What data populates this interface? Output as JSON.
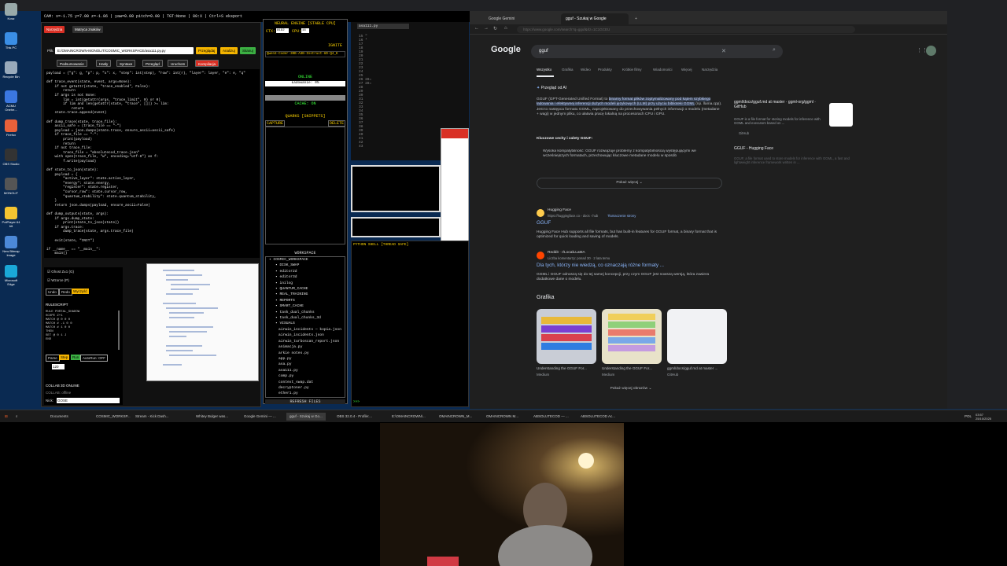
{
  "desktop_icons": [
    {
      "label": "Kosz",
      "color": "#9aa"
    },
    {
      "label": "This PC",
      "color": "#3a8ee6"
    },
    {
      "label": "Recycle Bin",
      "color": "#9ab"
    },
    {
      "label": "ACMU Onehe...",
      "color": "#3b77e0"
    },
    {
      "label": "Firefox",
      "color": "#e8603a"
    },
    {
      "label": "OBS Studio",
      "color": "#333"
    },
    {
      "label": "MONOLIT",
      "color": "#555"
    },
    {
      "label": "PotPlayer 64 bit",
      "color": "#f4c531"
    },
    {
      "label": "New Bitmap Image",
      "color": "#4c89d8"
    },
    {
      "label": "Microsoft Edge",
      "color": "#1aa8d8"
    }
  ],
  "left_app": {
    "status": "CAM: x=-1.75 y=7.00 z=-1.86 | yaw=0.00 pitch=0.00 | TGT:None | 80:X | Ctrl+S eksport",
    "tab_active": "Narzędzia",
    "tab_inactive": "Matryca znaków",
    "file_label": "Plik:",
    "file_path": "E:/OMAINCROWN-MONOLIT/COSMIC_WORKSPACE/asa111.py.py",
    "btn_load": "Przeglądaj",
    "btn_analyze": "Analizuj",
    "btn_scan": "Skanuj",
    "actions": [
      "Podsumowanie",
      "Hasły",
      "Syntaxe",
      "Przegląd",
      "Uruchom",
      "Kompilacja"
    ],
    "code": "payload = {\"g\": g, \"p\": p, \"x\": x, \"step\": int(step), \"row\": int(r), \"layer\": layer, \"e\": e, \"q\"\n\ndef trace_event(state, event, args=None):\n    if not getattr(state, \"trace_enabled\", False):\n        return\n    if args is not None:\n        lim = int(getattr(args, \"trace_limit\", 0) or 0)\n        if lim and len(getattr(state, \"trace\", [])) >= lim:\n            return\n    state.trace.append(event)\n\ndef dump_trace(state, trace_file):\n    ascii_safe = (trace_file == \"-\")\n    payload = json.dumps(state.trace, ensure_ascii=ascii_safe)\n    if trace_file == \"-\":\n        print(payload)\n        return\n    if not trace_file:\n        trace_file = \"absolutecod_trace.json\"\n    with open(trace_file, \"w\", encoding=\"utf-8\") as f:\n        f.write(payload)\n\ndef state_to_json(state):\n    payload = {\n        \"active_layer\": state.active_layer,\n        \"energy\": state.energy,\n        \"register\": state.register,\n        \"cursor_row\": state.cursor_row,\n        \"quantum_stability\": state.quantum_stability,\n    }\n    return json.dumps(payload, ensure_ascii=False)\n\ndef dump_outputs(state, args):\n    if args.dump_state:\n        print(state_to_json(state))\n    if args.trace:\n        dump_trace(state, args.trace_file)\n\n    exit(state, \"INIT\")\n\nif __name__ == \"__main__\":\n    main()",
    "ghost_label": "Ghost Z±1 (G)",
    "pattern_label": "Wzorce (P)",
    "undo": "Undo",
    "redo": "Redo",
    "clear": "Wyczyść",
    "rulescript_title": "RULESCRIPT",
    "rulescript": "RULE PORTAL_SHADOW\nSCOPE Z+1\nMATCH @ 0 0 0\nMATCH # -1 0 0\nMATCH # 1 0 0\nTHEN\nSET @ 0 1 J\nEND",
    "parse": "Parse",
    "step": "Step",
    "run": "Run",
    "autorun": "AutoRun: OFF",
    "ms_value": "120",
    "collab_title": "COLLAB 3D ONLINE",
    "collab_line": "COLLAB: offline",
    "nick_label": "Nick:",
    "nick_value": "GOSE"
  },
  "neural": {
    "title": "NEURAL ENGINE [STABLE CPU]",
    "ctx_label": "CTX:",
    "ctx_value": "8192",
    "cpu_label": "CPU:",
    "cpu_value": "16",
    "ignite": "IGNITE",
    "model": "Qwen3-Coder-30B-A3B-Instruct-UD-Q4_K",
    "online": "ONLINE",
    "loading": "Ładowanie: 0%",
    "cache": "CACHE: ON",
    "quarks": "QUARKS [SNIPPETS]",
    "capture": "CAPTURE",
    "delete": "DELETE",
    "workspace_title": "WORKSPACE",
    "tree": [
      "COSMIC_WORKSPACE",
      "DISK_SWAP",
      "editor2d",
      "editor3d",
      "inilog",
      "QUANTUM_CACHE",
      "REAL_TRAINING",
      "REPORTS",
      "SMART_CACHE",
      "task_dual_chunks",
      "task_dual_chunks_3d",
      "VISUALS",
      "airwin_incidents — kopia.json",
      "airwin_incidents.json",
      "airwin_turboscan_report.json",
      "animacja.py",
      "arkie notes.py",
      "app.py",
      "asa.py",
      "asa111.py",
      "comp.py",
      "context_swap.dat",
      "decryptoner.py",
      "ether1.py"
    ],
    "refresh": "REFRESH FILES"
  },
  "editor2": {
    "tab": "asa111.py",
    "lines": [
      "15 \"",
      "16 *",
      "17",
      "18",
      "19",
      "20",
      "21",
      "22",
      "23",
      "24",
      "25",
      "26 28=",
      "27 28=",
      "28",
      "29",
      "30",
      "31",
      "32",
      "33",
      "34",
      "35",
      "36",
      "37",
      "38",
      "39",
      "40",
      "41",
      "42",
      "43"
    ],
    "shell_title": "PYTHON SHELL [THREAD SAFE]",
    "shell_prompt": ">>>"
  },
  "chrome": {
    "tabs": [
      "Google Gemini",
      "gguf - Szukaj w Google"
    ],
    "url": "https://www.google.com/search?q=gguf&rlz=1C1GCEU",
    "logo": "Google",
    "query": "gguf",
    "nav": [
      "Wszystko",
      "Grafika",
      "Wideo",
      "Produkty",
      "Krótkie filmy",
      "Wiadomości",
      "Więcej",
      "Narzędzia"
    ],
    "ai_label": "Przegląd od AI",
    "ai_p1a": "GGUF (GPT-Generated Unified Format) to",
    "ai_p1b": "binarny format plików zoptymalizowany pod kątem szybkiego ładowania i efektywnej inferencji dużych modeli językowych (LLM) przy użyciu biblioteki GGML",
    "ai_p1c": "(np. llama.cpp). Jest to następca formatu GGML, zaprojektowany do przechowywania pełnych informacji o modelu (metadane + wagi) w jednym pliku, co ułatwia pracę lokalną na procesorach CPU i GPU.",
    "ai_h": "Kluczowe cechy i zalety GGUF:",
    "ai_b1": "Wysoka kompatybilność: GGUF rozwiązuje problemy z kompatybilnością występującymi we wcześniejszych formatach, przechowując kluczowe metadane modelu w sposób",
    "show_more": "Pokaż więcej",
    "side1_title": "ggml/docs/gguf.md at master · ggml-org/ggml · GitHub",
    "side1_desc": "GGUF is a file format for storing models for inference with GGML and executors based on ...",
    "side1_src": "GitHub",
    "side2_title": "GGUF - Hugging Face",
    "side2_desc": "GGUF, a file format used to store models for inference with GGML, a fast and lightweight inference framework written in ...",
    "r1_site": "Hugging Face",
    "r1_url": "https://huggingface.co › docs › hub",
    "r1_translate": "Tłumaczenie strony",
    "r1_title": "GGUF",
    "r1_desc": "Hugging Face Hub supports all file formats, but has built-in features for GGUF format, a binary format that is optimized for quick loading and saving of models.",
    "r2_site": "Reddit · r/LocalLLaMA",
    "r2_url": "Liczba komentarzy: ponad 30 · 2 lata temu",
    "r2_title": "Dla tych, którzy nie wiedzą, co oznaczają różne formaty ...",
    "r2_desc": "GGML i GGUF odnoszą się do tej samej koncepcji, przy czym GGUF jest nowszą wersją, która zawiera dodatkowe dane o modelu.",
    "graf_title": "Grafika",
    "img_caps": [
      "Understanding the GGUF For...",
      "Understanding the GGUF For...",
      "ggml/docs/gguf.md at master ..."
    ],
    "img_srcs": [
      "Medium",
      "Medium",
      "GitHub"
    ],
    "more_images": "Pokaż więcej obrazów"
  },
  "taskbar": {
    "items": [
      "Documents",
      "COSMIC_WORKSP...",
      "Stream - Kick Dash...",
      "Whitey Bulger was...",
      "Google Gemini — ...",
      "gguf - Szukaj w Go...",
      "OBS 32.0.4 - Profile:...",
      "E:\\OMAINCROWN\\...",
      "OMAINCROWN_M...",
      "OMAINCROWN M...",
      "ABSOLUTECOD — ...",
      "ABSOLUTECOD Ac..."
    ],
    "lang": "POL",
    "time": "03:57",
    "date": "25/10/2025"
  },
  "colors": {
    "accent_red": "#d93025",
    "google_link": "#8ab4f8",
    "neon_yellow": "#ffd400",
    "neon_green": "#3cff3c"
  }
}
